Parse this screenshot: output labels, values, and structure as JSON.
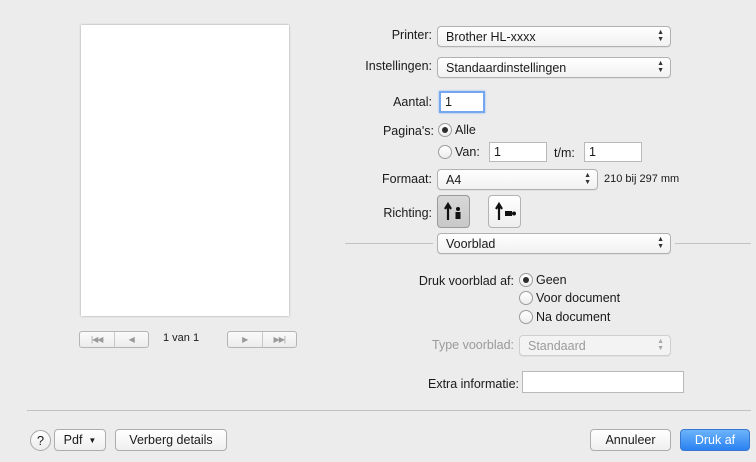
{
  "preview": {
    "page_indicator": "1 van 1"
  },
  "settings": {
    "printer_label": "Printer:",
    "printer_value": "Brother HL-xxxx",
    "presets_label": "Instellingen:",
    "presets_value": "Standaardinstellingen",
    "copies_label": "Aantal:",
    "copies_value": "1",
    "pages_label": "Pagina's:",
    "pages_all": "Alle",
    "pages_from_label": "Van:",
    "pages_from_value": "1",
    "pages_to_label": "t/m:",
    "pages_to_value": "1",
    "format_label": "Formaat:",
    "format_value": "A4",
    "format_size": "210 bij 297 mm",
    "orientation_label": "Richting:"
  },
  "section": {
    "selected": "Voorblad"
  },
  "cover": {
    "print_cover_label": "Druk voorblad af:",
    "options": [
      "Geen",
      "Voor document",
      "Na document"
    ],
    "selected_index": 0,
    "type_label": "Type voorblad:",
    "type_value": "Standaard",
    "extra_label": "Extra informatie:",
    "extra_value": ""
  },
  "footer": {
    "help": "?",
    "pdf": "Pdf",
    "hide_details": "Verberg details",
    "cancel": "Annuleer",
    "print": "Druk af"
  },
  "icons": [
    "first-page-icon",
    "prev-page-icon",
    "next-page-icon",
    "last-page-icon",
    "portrait-icon",
    "landscape-icon",
    "help-icon",
    "chevron-updown-icon",
    "chevron-down-icon"
  ],
  "colors": {
    "accent": "#2a82f2",
    "background": "#ececec"
  }
}
